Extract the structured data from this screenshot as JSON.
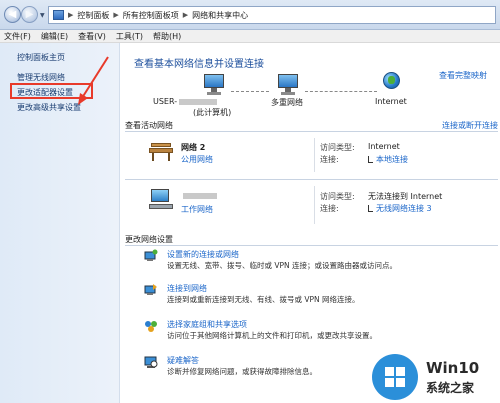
{
  "breadcrumb": [
    "控制面板",
    "所有控制面板项",
    "网络和共享中心"
  ],
  "menu": [
    "文件(F)",
    "编辑(E)",
    "查看(V)",
    "工具(T)",
    "帮助(H)"
  ],
  "sidebar": {
    "items": [
      {
        "label": "控制面板主页"
      },
      {
        "label": "管理无线网络"
      },
      {
        "label": "更改适配器设置"
      },
      {
        "label": "更改高级共享设置"
      }
    ]
  },
  "main": {
    "title": "查看基本网络信息并设置连接",
    "view_full_map": "查看完整映射",
    "map": {
      "computer_prefix": "USER-",
      "computer_sub": "(此计算机)",
      "network": "多重网络",
      "internet": "Internet"
    },
    "active_title": "查看活动网络",
    "connect_link": "连接或断开连接",
    "networks": [
      {
        "name": "网络 2",
        "type": "公用网络",
        "access_label": "访问类型:",
        "access": "Internet",
        "conn_label": "连接:",
        "conn": "本地连接"
      },
      {
        "name": "",
        "type": "工作网络",
        "access_label": "访问类型:",
        "access": "无法连接到 Internet",
        "conn_label": "连接:",
        "conn": "无线网络连接 3"
      }
    ],
    "change_title": "更改网络设置",
    "tasks": [
      {
        "title": "设置新的连接或网络",
        "desc": "设置无线、宽带、拨号、临时或 VPN 连接；或设置路由器或访问点。",
        "icon": "new-connection-icon"
      },
      {
        "title": "连接到网络",
        "desc": "连接到或重新连接到无线、有线、拨号或 VPN 网络连接。",
        "icon": "connect-network-icon"
      },
      {
        "title": "选择家庭组和共享选项",
        "desc": "访问位于其他网络计算机上的文件和打印机，或更改共享设置。",
        "icon": "homegroup-icon"
      },
      {
        "title": "疑难解答",
        "desc": "诊断并修复网络问题，或获得故障排除信息。",
        "icon": "troubleshoot-icon"
      }
    ]
  },
  "watermark": {
    "line1": "Win10",
    "line2": "系统之家"
  },
  "colors": {
    "link": "#1b66c9",
    "title": "#1d4f9c",
    "highlight": "#e83a2a"
  }
}
